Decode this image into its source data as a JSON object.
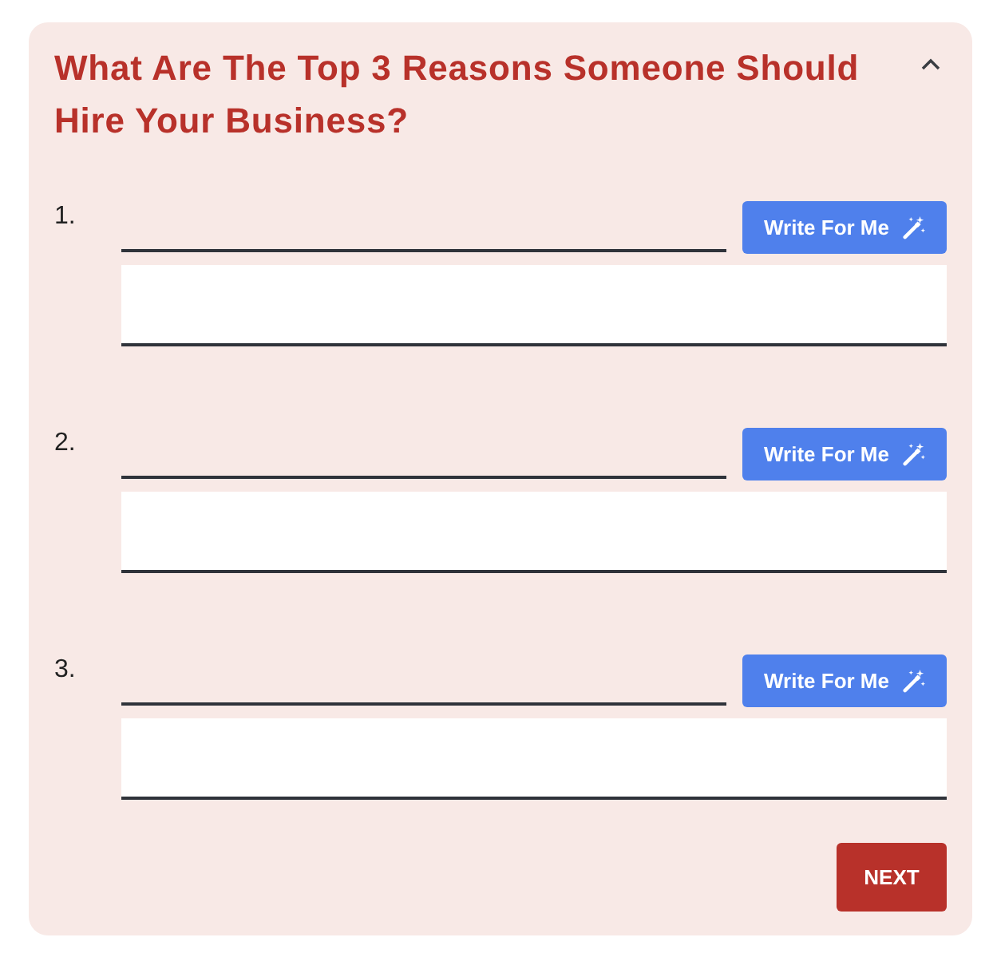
{
  "card": {
    "title": "What Are The Top 3 Reasons Someone Should Hire Your Business?",
    "expanded": true
  },
  "reasons": [
    {
      "number": "1.",
      "write_button": "Write For Me"
    },
    {
      "number": "2.",
      "write_button": "Write For Me"
    },
    {
      "number": "3.",
      "write_button": "Write For Me"
    }
  ],
  "next_button": "NEXT"
}
